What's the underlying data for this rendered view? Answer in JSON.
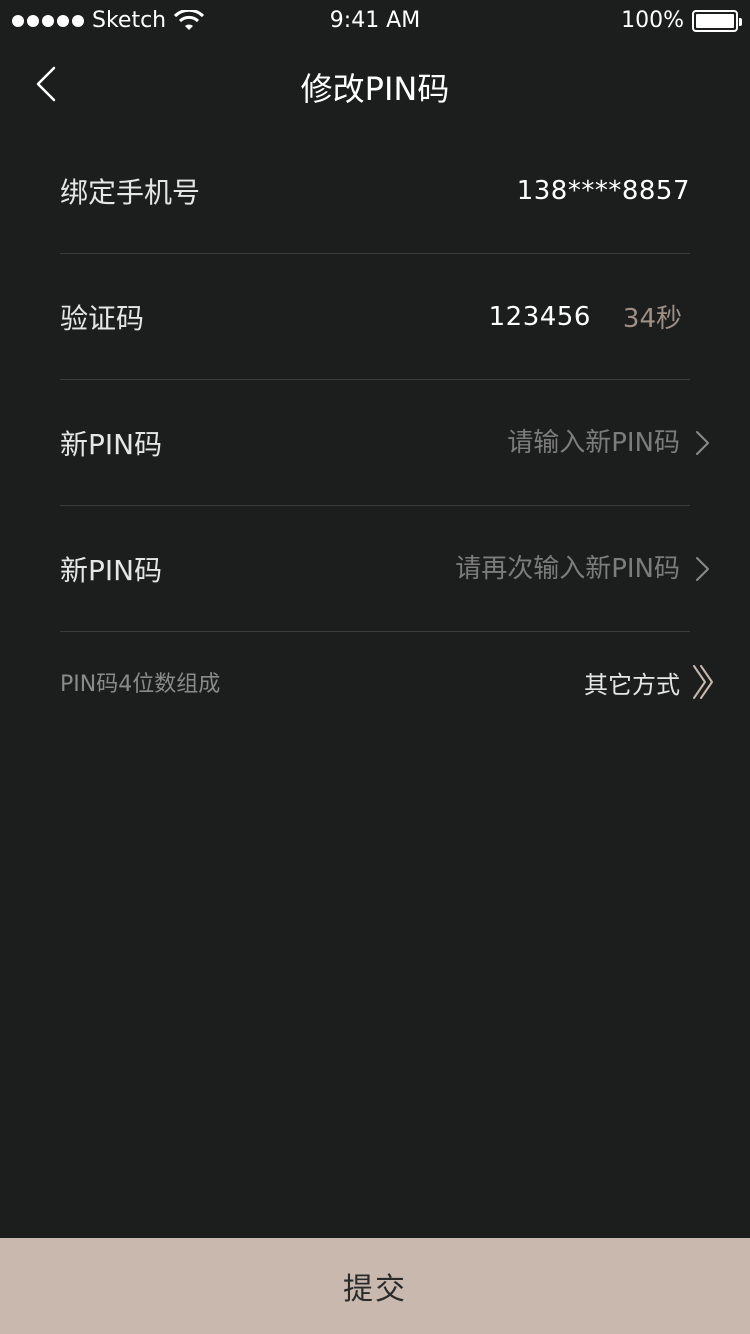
{
  "status_bar": {
    "carrier": "Sketch",
    "time": "9:41 AM",
    "battery": "100%",
    "battery_level": 1.0
  },
  "nav": {
    "title": "修改PIN码",
    "back_icon": "chevron-left-icon"
  },
  "form": {
    "phone": {
      "label": "绑定手机号",
      "value": "138****8857"
    },
    "code": {
      "label": "验证码",
      "value": "123456",
      "countdown": "34秒"
    },
    "new_pin": {
      "label": "新PIN码",
      "placeholder": "请输入新PIN码",
      "value": ""
    },
    "confirm_pin": {
      "label": "新PIN码",
      "placeholder": "请再次输入新PIN码",
      "value": ""
    },
    "hint": "PIN码4位数组成",
    "other_method": "其它方式"
  },
  "submit": {
    "label": "提交"
  },
  "colors": {
    "background": "#1c1d1d",
    "divider": "#3a3b3b",
    "accent": "#c8b8ae",
    "countdown": "#9d8f84"
  }
}
